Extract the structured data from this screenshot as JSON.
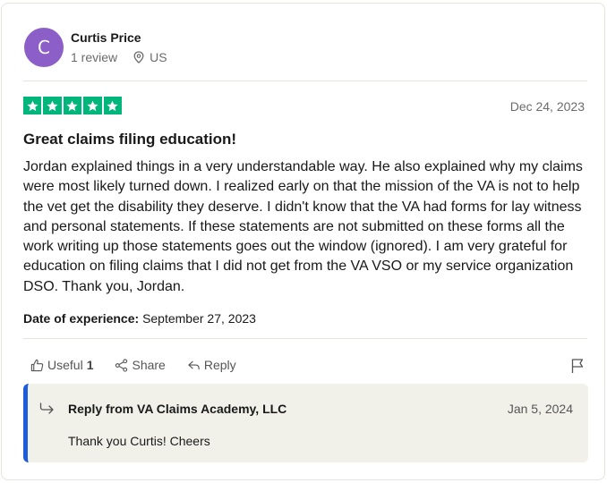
{
  "reviewer": {
    "initial": "C",
    "name": "Curtis Price",
    "reviews": "1 review",
    "country": "US"
  },
  "review": {
    "rating": 5,
    "max_rating": 5,
    "date": "Dec 24, 2023",
    "title": "Great claims filing education!",
    "text": "Jordan explained things in a very understandable way. He also explained why my claims were most likely turned down. I realized early on that the mission of the VA is not to help the vet get the disability they deserve. I didn't know that the VA had forms for lay witness and personal statements. If these statements are not submitted on these forms all the work writing up those statements goes out the window (ignored). I am very grateful for education on filing claims that I did not get from the VA VSO or my service organization DSO. Thank you, Jordan.",
    "experience_label": "Date of experience:",
    "experience_date": "September 27, 2023"
  },
  "actions": {
    "useful_label": "Useful",
    "useful_count": "1",
    "share_label": "Share",
    "reply_label": "Reply"
  },
  "reply": {
    "title": "Reply from VA Claims Academy, LLC",
    "date": "Jan 5, 2024",
    "text": "Thank you Curtis! Cheers"
  },
  "colors": {
    "star_green": "#00b67a",
    "avatar_purple": "#8b5fc7",
    "reply_accent": "#1c5bd9",
    "reply_bg": "#f1f1ea"
  },
  "icons": [
    "location-pin-icon",
    "star-icon",
    "thumbs-up-icon",
    "share-icon",
    "reply-arrow-icon",
    "flag-icon",
    "reply-indicator-icon"
  ]
}
